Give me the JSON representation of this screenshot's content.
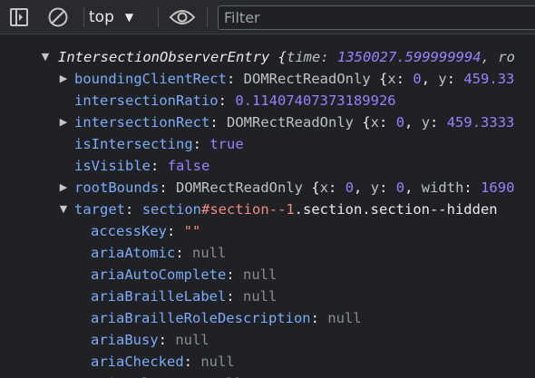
{
  "toolbar": {
    "sidebar_icon": "sidebar-toggle-icon",
    "clear_icon": "clear-console-icon",
    "context_label": "top",
    "context_caret": "▼",
    "eye_icon": "live-expression-eye-icon",
    "filter_placeholder": "Filter"
  },
  "colors": {
    "background": "#202124",
    "toolbar": "#292a2d",
    "key": "#7cacf8",
    "number": "#9980ff",
    "string": "#f28b82",
    "null": "#8a8d91"
  },
  "entry": {
    "class_name": "IntersectionObserverEntry",
    "open_brace": "{",
    "preview_key": "time",
    "preview_colon": ":",
    "preview_value": "1350027.599999994",
    "preview_tail": ", ro",
    "props": {
      "bcr": {
        "key": "boundingClientRect",
        "colon": ":",
        "type": "DOMRectReadOnly",
        "brace": "{",
        "x_key": "x",
        "x_val": "0",
        "y_key": "y",
        "y_val": "459.33"
      },
      "ratio": {
        "key": "intersectionRatio",
        "colon": ":",
        "value": "0.11407407373189926"
      },
      "irect": {
        "key": "intersectionRect",
        "colon": ":",
        "type": "DOMRectReadOnly",
        "brace": "{",
        "x_key": "x",
        "x_val": "0",
        "y_key": "y",
        "y_val": "459.3333"
      },
      "isIntersecting": {
        "key": "isIntersecting",
        "colon": ":",
        "value": "true"
      },
      "isVisible": {
        "key": "isVisible",
        "colon": ":",
        "value": "false"
      },
      "rootBounds": {
        "key": "rootBounds",
        "colon": ":",
        "type": "DOMRectReadOnly",
        "brace": "{",
        "x_key": "x",
        "x_val": "0",
        "y_key": "y",
        "y_val": "0",
        "w_key": "width",
        "w_val": "1690"
      },
      "target": {
        "key": "target",
        "colon": ":",
        "tag": "section",
        "id": "#section--1",
        "classes": ".section.section--hidden"
      }
    },
    "target_children": [
      {
        "key": "accessKey",
        "value": "\"\"",
        "kind": "str"
      },
      {
        "key": "ariaAtomic",
        "value": "null",
        "kind": "nul"
      },
      {
        "key": "ariaAutoComplete",
        "value": "null",
        "kind": "nul"
      },
      {
        "key": "ariaBrailleLabel",
        "value": "null",
        "kind": "nul"
      },
      {
        "key": "ariaBrailleRoleDescription",
        "value": "null",
        "kind": "nul"
      },
      {
        "key": "ariaBusy",
        "value": "null",
        "kind": "nul"
      },
      {
        "key": "ariaChecked",
        "value": "null",
        "kind": "nul"
      }
    ],
    "partial_row": {
      "key": "ariaColCount",
      "value": "null"
    }
  }
}
